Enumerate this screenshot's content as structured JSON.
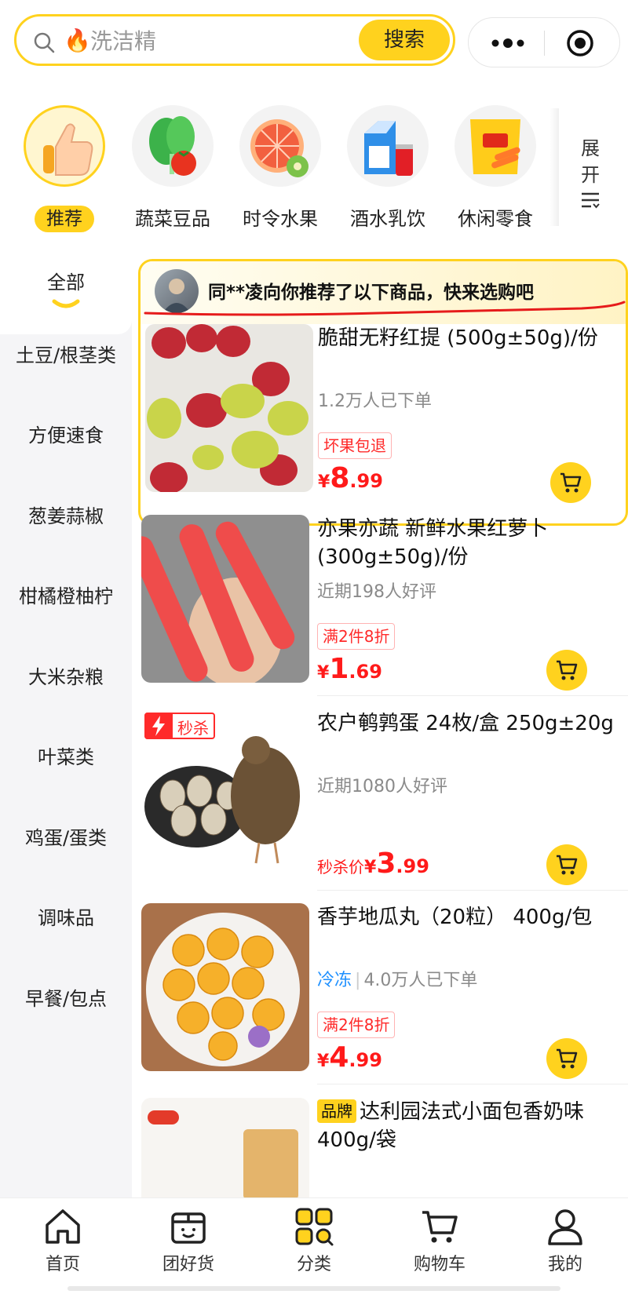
{
  "search": {
    "placeholder": "洗洁精",
    "hot_icon": "fire-icon",
    "button_label": "搜索"
  },
  "capsule": {
    "more_icon": "more-dots-icon",
    "close_icon": "target-circle-icon"
  },
  "categories": [
    {
      "label": "推荐",
      "icon": "thumbs-up-icon",
      "active": true
    },
    {
      "label": "蔬菜豆品",
      "icon": "vegetable-icon",
      "active": false
    },
    {
      "label": "时令水果",
      "icon": "fruit-icon",
      "active": false
    },
    {
      "label": "酒水乳饮",
      "icon": "drinks-icon",
      "active": false
    },
    {
      "label": "休闲零食",
      "icon": "snacks-icon",
      "active": false
    }
  ],
  "expand": {
    "label": "展开",
    "icon": "list-expand-icon"
  },
  "sidebar": {
    "active": "全部",
    "items": [
      "土豆/根茎类",
      "方便速食",
      "葱姜蒜椒",
      "柑橘橙柚柠",
      "大米杂粮",
      "叶菜类",
      "鸡蛋/蛋类",
      "调味品",
      "早餐/包点"
    ]
  },
  "recommend_banner": {
    "text": "同**凌向你推荐了以下商品，快来选购吧"
  },
  "products": [
    {
      "name": "脆甜无籽红提 (500g±50g)/份",
      "meta": "1.2万人已下单",
      "tag": "坏果包退",
      "price_prefix": "",
      "price_yen": "¥",
      "price_int": "8",
      "price_dec": ".99"
    },
    {
      "name": "亦果亦蔬 新鲜水果红萝卜 (300g±50g)/份",
      "meta": "近期198人好评",
      "tag": "满2件8折",
      "price_prefix": "",
      "price_yen": "¥",
      "price_int": "1",
      "price_dec": ".69"
    },
    {
      "name": "农户鹌鹑蛋 24枚/盒 250g±20g",
      "meta": "近期1080人好评",
      "flash_label": "秒杀",
      "price_prefix": "秒杀价",
      "price_yen": "¥",
      "price_int": "3",
      "price_dec": ".99"
    },
    {
      "name": "香芋地瓜丸（20粒） 400g/包",
      "meta_cold": "冷冻",
      "meta": "4.0万人已下单",
      "tag": "满2件8折",
      "price_prefix": "",
      "price_yen": "¥",
      "price_int": "4",
      "price_dec": ".99"
    },
    {
      "brand_badge": "品牌",
      "name": "达利园法式小面包香奶味 400g/袋"
    }
  ],
  "tabbar": [
    {
      "label": "首页",
      "icon": "home-icon"
    },
    {
      "label": "团好货",
      "icon": "gift-box-icon"
    },
    {
      "label": "分类",
      "icon": "category-icon"
    },
    {
      "label": "购物车",
      "icon": "cart-icon"
    },
    {
      "label": "我的",
      "icon": "profile-icon"
    }
  ],
  "colors": {
    "accent": "#ffd21e",
    "price": "#ff1a1a",
    "cold_chain": "#1e90ff"
  }
}
